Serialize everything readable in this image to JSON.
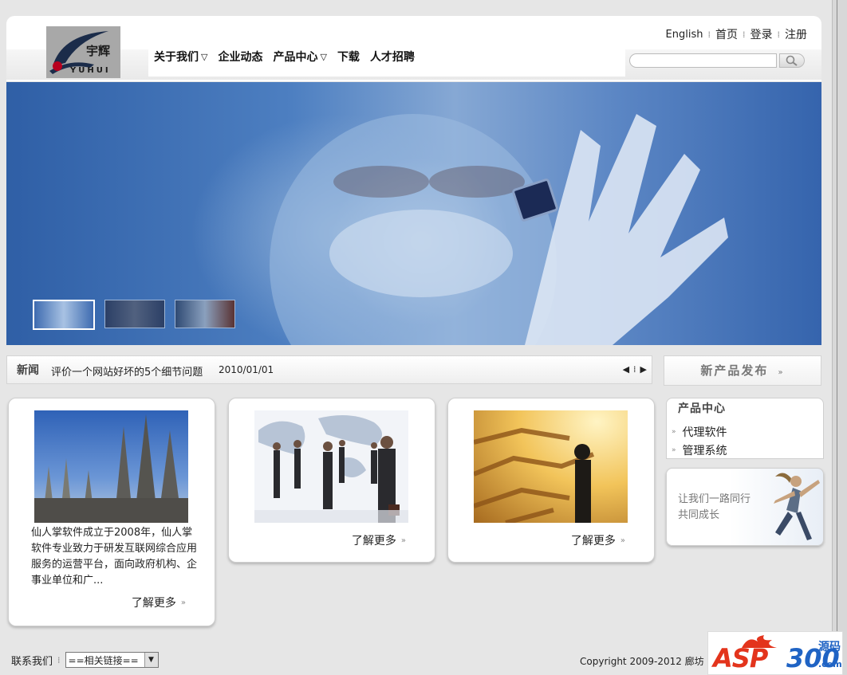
{
  "logo": {
    "brand_cn": "宇辉",
    "brand_en": "YUHUI"
  },
  "nav": {
    "items": [
      {
        "label": "关于我们",
        "has_dropdown": true
      },
      {
        "label": "企业动态",
        "has_dropdown": false
      },
      {
        "label": "产品中心",
        "has_dropdown": true
      },
      {
        "label": "下载",
        "has_dropdown": false
      },
      {
        "label": "人才招聘",
        "has_dropdown": false
      }
    ]
  },
  "toplinks": {
    "english": "English",
    "home": "首页",
    "login": "登录",
    "register": "注册"
  },
  "search": {
    "value": "",
    "placeholder": ""
  },
  "banner": {
    "thumbnails": 3,
    "active_index": 0
  },
  "news": {
    "label": "新闻",
    "title": "评价一个网站好坏的5个细节问题",
    "date": "2010/01/01"
  },
  "new_products": {
    "label": "新产品发布"
  },
  "cards": [
    {
      "desc": "仙人掌软件成立于2008年，仙人掌软件专业致力于研发互联网综合应用服务的运营平台，面向政府机构、企事业单位和广...",
      "more": "了解更多"
    },
    {
      "more": "了解更多"
    },
    {
      "more": "了解更多"
    }
  ],
  "product_center": {
    "title": "产品中心",
    "items": [
      "代理软件",
      "管理系统"
    ]
  },
  "promo": {
    "line1": "让我们一路同行",
    "line2": "共同成长"
  },
  "footer": {
    "contact": "联系我们",
    "links_select": "==相关链接==",
    "copyright": "Copyright 2009-2012 廊坊"
  },
  "watermark": {
    "asp": "ASP",
    "num": "300",
    "cn": "源码",
    "com": ".com"
  },
  "colors": {
    "banner_blue": "#4d7fc1",
    "watermark_red": "#e3341c",
    "watermark_blue": "#1f63c4"
  }
}
